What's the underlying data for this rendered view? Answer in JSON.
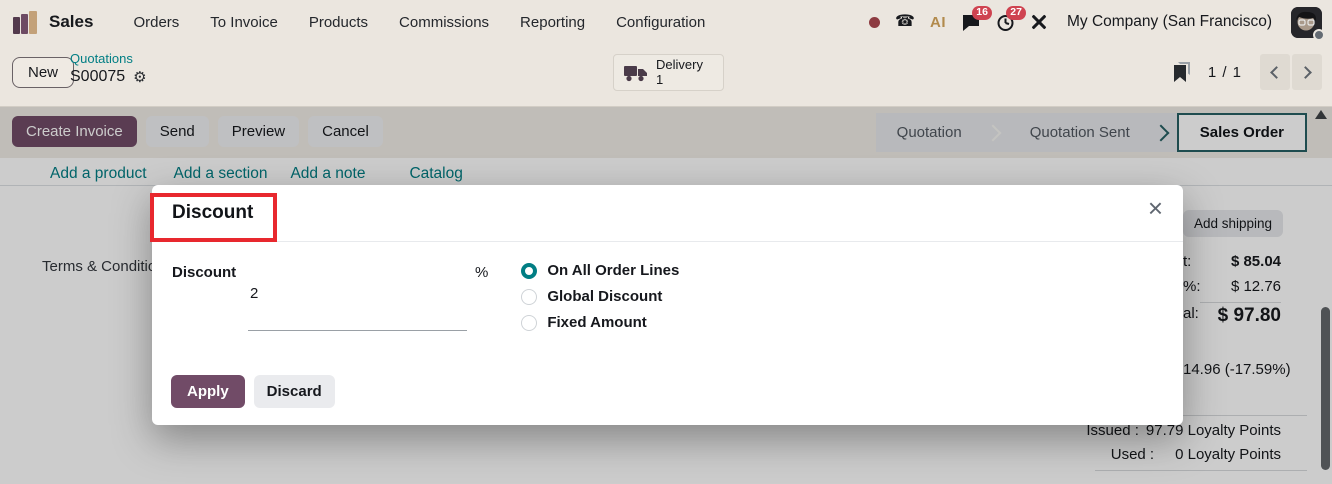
{
  "nav": {
    "app_name": "Sales",
    "items": [
      "Orders",
      "To Invoice",
      "Products",
      "Commissions",
      "Reporting",
      "Configuration"
    ],
    "company": "My Company (San Francisco)",
    "messages_badge": "16",
    "activities_badge": "27"
  },
  "control_panel": {
    "new_button": "New",
    "breadcrumb_parent": "Quotations",
    "breadcrumb_current": "S00075",
    "delivery": {
      "label": "Delivery",
      "count": "1"
    },
    "pager": "1 / 1"
  },
  "actions": {
    "create_invoice": "Create Invoice",
    "send": "Send",
    "preview": "Preview",
    "cancel": "Cancel"
  },
  "statusbar": {
    "steps": [
      "Quotation",
      "Quotation Sent",
      "Sales Order"
    ],
    "active_step": "Sales Order"
  },
  "sheet": {
    "links": [
      "Add a product",
      "Add a section",
      "Add a note"
    ],
    "catalog_link": "Catalog",
    "terms_fragment": "Terms & Conditio",
    "add_shipping": "Add shipping",
    "totals": [
      {
        "label": "t:",
        "value": "$ 85.04"
      },
      {
        "label": "%:",
        "value": "$ 12.76"
      },
      {
        "label": "al:",
        "value": "$ 97.80"
      }
    ],
    "margin_fragment": "14.96 (-17.59%)",
    "loyalty": [
      {
        "label": "Issued :",
        "value": "97.79 Loyalty Points"
      },
      {
        "label": "Used :",
        "value": "0 Loyalty Points"
      }
    ]
  },
  "modal": {
    "title": "Discount",
    "close": "×",
    "field_label": "Discount",
    "field_value": "2",
    "unit": "%",
    "options": [
      "On All Order Lines",
      "Global Discount",
      "Fixed Amount"
    ],
    "selected_option": "On All Order Lines",
    "apply": "Apply",
    "discard": "Discard"
  },
  "icons": {
    "gear": "⚙",
    "phone": "☎",
    "ai": "AI"
  },
  "colors": {
    "primary_purple": "#714B67",
    "accent_teal": "#017E84",
    "annotation_red": "#E8282E",
    "badge_red": "#CF4350",
    "topbar_beige": "#EBE6DF"
  }
}
